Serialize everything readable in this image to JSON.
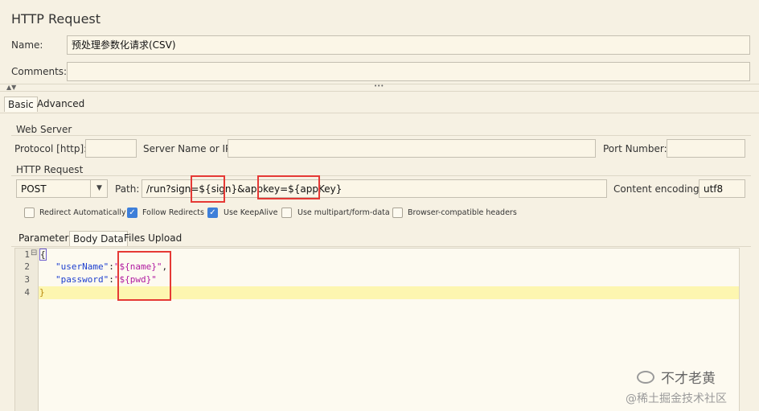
{
  "title": "HTTP Request",
  "name_label": "Name:",
  "name_value": "预处理参数化请求(CSV)",
  "comments_label": "Comments:",
  "comments_value": "",
  "collapse_dots": "•••",
  "tabs": {
    "basic": "Basic",
    "advanced": "Advanced"
  },
  "web_server": {
    "section": "Web Server",
    "protocol_label": "Protocol [http]:",
    "protocol_value": "",
    "server_label": "Server Name or IP:",
    "server_value": "",
    "port_label": "Port Number:",
    "port_value": ""
  },
  "http_request": {
    "section": "HTTP Request",
    "method": "POST",
    "path_label": "Path:",
    "path_value": "/run?sign=${sign}&appkey=${appKey}",
    "encoding_label": "Content encoding:",
    "encoding_value": "utf8"
  },
  "options": [
    {
      "label": "Redirect Automatically",
      "checked": false
    },
    {
      "label": "Follow Redirects",
      "checked": true
    },
    {
      "label": "Use KeepAlive",
      "checked": true
    },
    {
      "label": "Use multipart/form-data",
      "checked": false
    },
    {
      "label": "Browser-compatible headers",
      "checked": false
    }
  ],
  "body_tabs": {
    "parameters": "Parameters",
    "body_data": "Body Data",
    "files_upload": "Files Upload"
  },
  "editor": {
    "line_numbers": [
      "1",
      "2",
      "3",
      "4"
    ],
    "fold_marker": "⊟",
    "open_brace": "{",
    "close_brace": "}",
    "line2_key": "\"userName\"",
    "line2_colon": ":",
    "line2_value": "\"${name}\"",
    "line2_comma": ",",
    "line3_key": "\"password\"",
    "line3_colon": ":",
    "line3_value": "\"${pwd}\""
  },
  "watermark": {
    "line1": "不才老黄",
    "line2": "@稀土掘金技术社区"
  },
  "colors": {
    "background": "#f6f1e3",
    "highlight_line": "#fdf6b0",
    "annotation": "#e53935",
    "checkbox": "#3e7fd9"
  }
}
